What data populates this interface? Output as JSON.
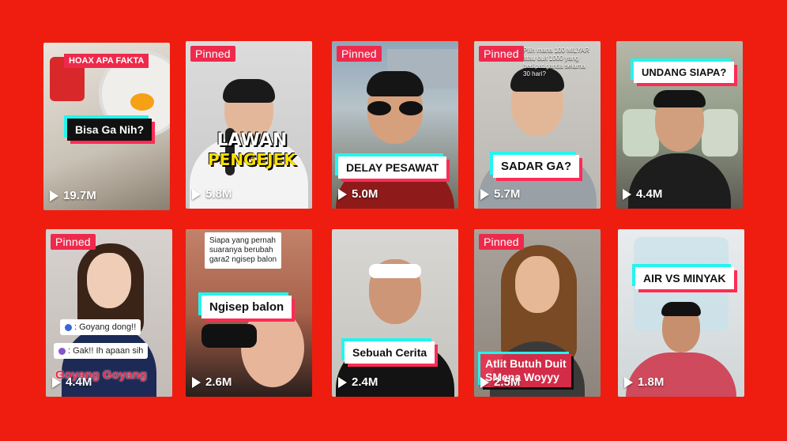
{
  "colors": {
    "background": "#ee1d10",
    "pinned": "#ee2a4c",
    "caption_cyan": "#25f4ee",
    "caption_pink": "#fe2c55"
  },
  "icons": {
    "play": "play-icon"
  },
  "videos": [
    {
      "pinned": false,
      "top_label": "HOAX APA FAKTA",
      "caption": "Bisa Ga Nih?",
      "views": "19.7M"
    },
    {
      "pinned": true,
      "pinned_label": "Pinned",
      "title_line1": "LAWAN",
      "title_line2": "PENGEJEK",
      "views": "5.8M"
    },
    {
      "pinned": true,
      "pinned_label": "Pinned",
      "caption": "DELAY PESAWAT",
      "views": "5.0M"
    },
    {
      "pinned": true,
      "pinned_label": "Pinned",
      "top_text": "Pilih mana 100 MILYAR\natau duit 1000 yang\nberlipat ganda selama\n30 hari?",
      "caption": "SADAR GA?",
      "views": "5.7M"
    },
    {
      "pinned": false,
      "caption": "UNDANG SIAPA?",
      "views": "4.4M"
    },
    {
      "pinned": true,
      "pinned_label": "Pinned",
      "chat1": ": Goyang dong!!",
      "chat2": ": Gak!! Ih apaan sih",
      "caption": "Goyang Goyang",
      "views": "4.4M"
    },
    {
      "pinned": false,
      "note": "Siapa yang pernah\nsuaranya berubah\ngara2 ngisep balon",
      "caption": "Ngisep balon",
      "views": "2.6M"
    },
    {
      "pinned": false,
      "caption": "Sebuah Cerita",
      "views": "2.4M"
    },
    {
      "pinned": true,
      "pinned_label": "Pinned",
      "caption": "Atlit Butuh Duit\nSMena Woyyy",
      "views": "2.5M"
    },
    {
      "pinned": false,
      "caption": "AIR VS MINYAK",
      "views": "1.8M"
    }
  ]
}
